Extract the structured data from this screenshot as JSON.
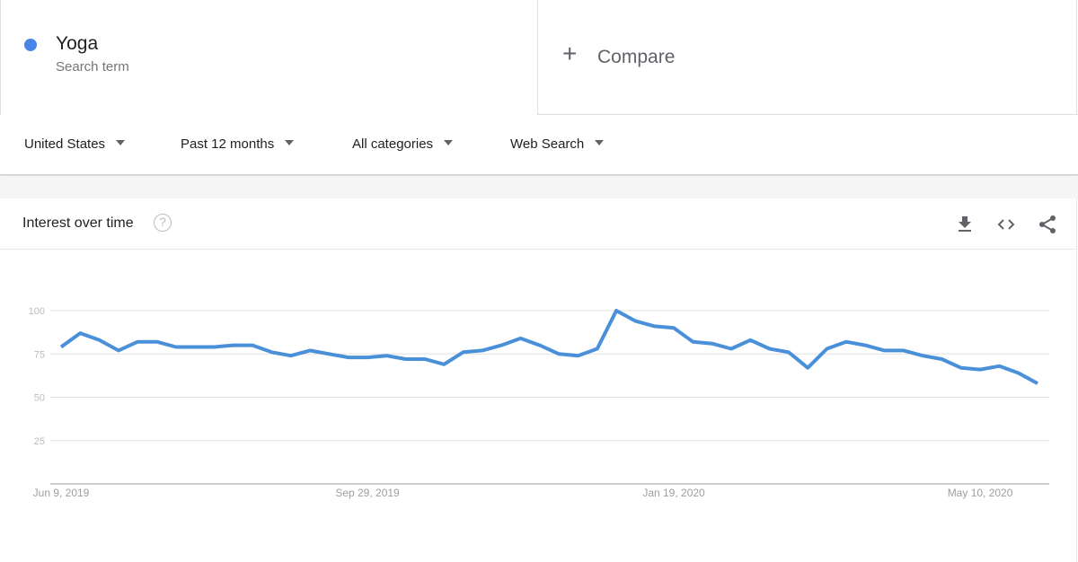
{
  "search_term": {
    "name": "Yoga",
    "subtitle": "Search term",
    "color": "#4a86e8"
  },
  "compare": {
    "icon": "plus-icon",
    "label": "Compare"
  },
  "filters": [
    {
      "label": "United States"
    },
    {
      "label": "Past 12 months"
    },
    {
      "label": "All categories"
    },
    {
      "label": "Web Search"
    }
  ],
  "panel": {
    "title": "Interest over time",
    "help_icon": "help-circle-icon",
    "help_glyph": "?",
    "tools": [
      "download-icon",
      "embed-code-icon",
      "share-icon"
    ]
  },
  "chart_data": {
    "type": "line",
    "title": "Interest over time",
    "xlabel": "",
    "ylabel": "",
    "ylim": [
      0,
      100
    ],
    "yticks": [
      25,
      50,
      75,
      100
    ],
    "grid": true,
    "legend": "none",
    "x_tick_labels": [
      {
        "index": 0,
        "label": "Jun 9, 2019"
      },
      {
        "index": 16,
        "label": "Sep 29, 2019"
      },
      {
        "index": 32,
        "label": "Jan 19, 2020"
      },
      {
        "index": 48,
        "label": "May 10, 2020"
      }
    ],
    "series": [
      {
        "name": "Yoga",
        "color": "#4a90d9",
        "values": [
          79,
          87,
          83,
          77,
          82,
          82,
          79,
          79,
          79,
          80,
          80,
          76,
          74,
          77,
          75,
          73,
          73,
          74,
          72,
          72,
          69,
          76,
          77,
          80,
          84,
          80,
          75,
          74,
          78,
          100,
          94,
          91,
          90,
          82,
          81,
          78,
          83,
          78,
          76,
          67,
          78,
          82,
          80,
          77,
          77,
          74,
          72,
          67,
          66,
          68,
          64,
          58
        ]
      }
    ]
  }
}
